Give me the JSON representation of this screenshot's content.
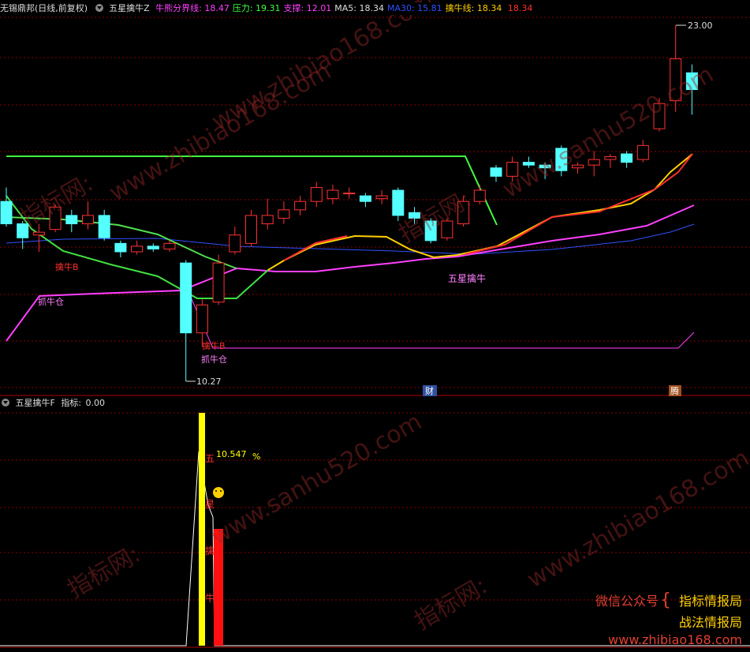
{
  "main_header": {
    "stock": "无锡鼎邦(日线,前复权)",
    "indicator_name": "五星擒牛Z",
    "items": [
      {
        "label": "牛熊分界线:",
        "value": "18.47",
        "color": "#ff40ff"
      },
      {
        "label": "压力:",
        "value": "19.31",
        "color": "#40ff40"
      },
      {
        "label": "支撑:",
        "value": "12.01",
        "color": "#ff40ff"
      },
      {
        "label": "MA5:",
        "value": "18.34",
        "color": "#dddddd"
      },
      {
        "label": "MA30:",
        "value": "15.81",
        "color": "#3050ff"
      },
      {
        "label": "擒牛线:",
        "value": "18.34",
        "color": "#ffd000"
      },
      {
        "label": "",
        "value": "18.34",
        "color": "#ff3030"
      }
    ]
  },
  "sub_header": {
    "indicator_name": "五星擒牛F",
    "label": "指标:",
    "value": "0.00"
  },
  "annotations": {
    "high_price": "23.00",
    "low_price": "10.27",
    "qinniu_b1": "擒牛B",
    "zhuaniu1": "抓牛仓",
    "qinniu_b2": "擒牛B",
    "zhuaniu2": "抓牛仓",
    "wuxing": "五星擒牛",
    "cai_badge": "财",
    "teng_badge": "腾",
    "sub_value": "10.547",
    "sub_pct": "%",
    "sub_chars": [
      "五",
      "星",
      "擒",
      "牛"
    ]
  },
  "watermarks": [
    "www.zhibiao168.com",
    "指标网:",
    "www.sanhu520.com"
  ],
  "ad": {
    "label": "微信公众号",
    "brace": "{",
    "title1": "指标情报局",
    "title2": "战法情报局",
    "url": "www.zhibiao168.com"
  },
  "colors": {
    "up": "#ff3232",
    "down": "#54ffff",
    "grid": "#8b0000",
    "ma30": "#3050ff",
    "bull_bear": "#ff40ff",
    "pressure": "#40ff40"
  },
  "chart_data": {
    "type": "candlestick",
    "price_range": [
      10.27,
      23.0
    ],
    "candles": [
      {
        "o": 16.7,
        "c": 15.9,
        "h": 17.2,
        "l": 15.8
      },
      {
        "o": 15.9,
        "c": 15.4,
        "h": 16.0,
        "l": 15.0
      },
      {
        "o": 15.5,
        "c": 15.6,
        "h": 15.9,
        "l": 14.9
      },
      {
        "o": 15.7,
        "c": 16.5,
        "h": 16.6,
        "l": 15.6
      },
      {
        "o": 16.2,
        "c": 15.9,
        "h": 16.4,
        "l": 15.6
      },
      {
        "o": 15.9,
        "c": 16.2,
        "h": 16.7,
        "l": 15.7
      },
      {
        "o": 16.2,
        "c": 15.4,
        "h": 16.4,
        "l": 15.3
      },
      {
        "o": 15.2,
        "c": 14.9,
        "h": 15.3,
        "l": 14.7
      },
      {
        "o": 14.9,
        "c": 15.1,
        "h": 15.3,
        "l": 14.8
      },
      {
        "o": 15.1,
        "c": 15.0,
        "h": 15.2,
        "l": 14.9
      },
      {
        "o": 15.0,
        "c": 15.2,
        "h": 15.3,
        "l": 14.9
      },
      {
        "o": 14.5,
        "c": 12.0,
        "h": 14.6,
        "l": 10.27
      },
      {
        "o": 12.0,
        "c": 13.0,
        "h": 13.2,
        "l": 11.5
      },
      {
        "o": 13.1,
        "c": 14.5,
        "h": 14.8,
        "l": 13.0
      },
      {
        "o": 14.9,
        "c": 15.5,
        "h": 15.8,
        "l": 14.8
      },
      {
        "o": 15.2,
        "c": 16.2,
        "h": 16.4,
        "l": 15.1
      },
      {
        "o": 15.9,
        "c": 16.2,
        "h": 16.8,
        "l": 15.7
      },
      {
        "o": 16.1,
        "c": 16.4,
        "h": 16.7,
        "l": 15.9
      },
      {
        "o": 16.4,
        "c": 16.7,
        "h": 16.9,
        "l": 16.2
      },
      {
        "o": 16.7,
        "c": 17.2,
        "h": 17.4,
        "l": 16.5
      },
      {
        "o": 16.8,
        "c": 17.1,
        "h": 17.3,
        "l": 16.6
      },
      {
        "o": 17.0,
        "c": 17.0,
        "h": 17.2,
        "l": 16.8
      },
      {
        "o": 16.9,
        "c": 16.7,
        "h": 17.0,
        "l": 16.5
      },
      {
        "o": 16.8,
        "c": 16.9,
        "h": 17.1,
        "l": 16.6
      },
      {
        "o": 17.1,
        "c": 16.2,
        "h": 17.2,
        "l": 16.0
      },
      {
        "o": 16.3,
        "c": 16.1,
        "h": 16.5,
        "l": 15.9
      },
      {
        "o": 16.0,
        "c": 15.3,
        "h": 16.1,
        "l": 15.2
      },
      {
        "o": 15.4,
        "c": 16.0,
        "h": 16.1,
        "l": 15.3
      },
      {
        "o": 15.9,
        "c": 16.7,
        "h": 16.9,
        "l": 15.8
      },
      {
        "o": 16.7,
        "c": 17.1,
        "h": 17.3,
        "l": 16.6
      },
      {
        "o": 17.9,
        "c": 17.6,
        "h": 18.0,
        "l": 17.4
      },
      {
        "o": 17.6,
        "c": 18.1,
        "h": 18.3,
        "l": 17.4
      },
      {
        "o": 18.1,
        "c": 18.0,
        "h": 18.3,
        "l": 17.9
      },
      {
        "o": 18.0,
        "c": 17.9,
        "h": 18.1,
        "l": 17.5
      },
      {
        "o": 18.6,
        "c": 17.8,
        "h": 18.7,
        "l": 17.6
      },
      {
        "o": 17.9,
        "c": 18.0,
        "h": 18.1,
        "l": 17.7
      },
      {
        "o": 18.0,
        "c": 18.2,
        "h": 18.5,
        "l": 17.6
      },
      {
        "o": 18.2,
        "c": 18.3,
        "h": 18.4,
        "l": 17.9
      },
      {
        "o": 18.4,
        "c": 18.1,
        "h": 18.5,
        "l": 17.9
      },
      {
        "o": 18.2,
        "c": 18.7,
        "h": 18.9,
        "l": 18.1
      },
      {
        "o": 19.3,
        "c": 20.2,
        "h": 20.4,
        "l": 19.2
      },
      {
        "o": 20.3,
        "c": 21.8,
        "h": 23.0,
        "l": 19.9
      },
      {
        "o": 21.3,
        "c": 20.7,
        "h": 21.6,
        "l": 19.8
      }
    ],
    "indicator_sub": {
      "peak": 10.547,
      "unit": "%"
    }
  }
}
